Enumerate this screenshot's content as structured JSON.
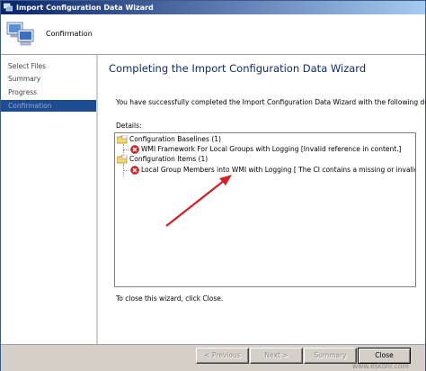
{
  "window": {
    "title": "Import Configuration Data Wizard",
    "icon": "wizard-icon"
  },
  "header": {
    "page_name": "Confirmation",
    "icon": "computers-icon"
  },
  "nav": {
    "items": [
      {
        "label": "Select Files"
      },
      {
        "label": "Summary"
      },
      {
        "label": "Progress"
      },
      {
        "label": "Confirmation",
        "active": true
      }
    ]
  },
  "main": {
    "title": "Completing the Import Configuration Data Wizard",
    "message": "You have successfully completed the Import Configuration Data Wizard with the following details.",
    "details_label": "Details:",
    "tree": [
      {
        "label": "Configuration Baselines (1)",
        "icon": "folder-icon",
        "children": [
          {
            "label": "WMI Framework For Local Groups with Logging [Invalid reference in content.]",
            "icon": "error-icon"
          }
        ]
      },
      {
        "label": "Configuration Items (1)",
        "icon": "folder-icon",
        "children": [
          {
            "label": "Local Group Members into WMI with Logging [ The CI contains a missing or invalid CI referen",
            "icon": "error-icon"
          }
        ]
      }
    ],
    "close_hint": "To close this wizard, click Close."
  },
  "buttons": {
    "previous": "< Previous",
    "next": "Next >",
    "summary": "Summary",
    "close": "Close"
  },
  "watermark": "www.eskonr.com",
  "colors": {
    "title_gradient_start": "#0a246a",
    "nav_active": "#1e4c91",
    "heading": "#0d2c69",
    "arrow": "#d42020"
  }
}
